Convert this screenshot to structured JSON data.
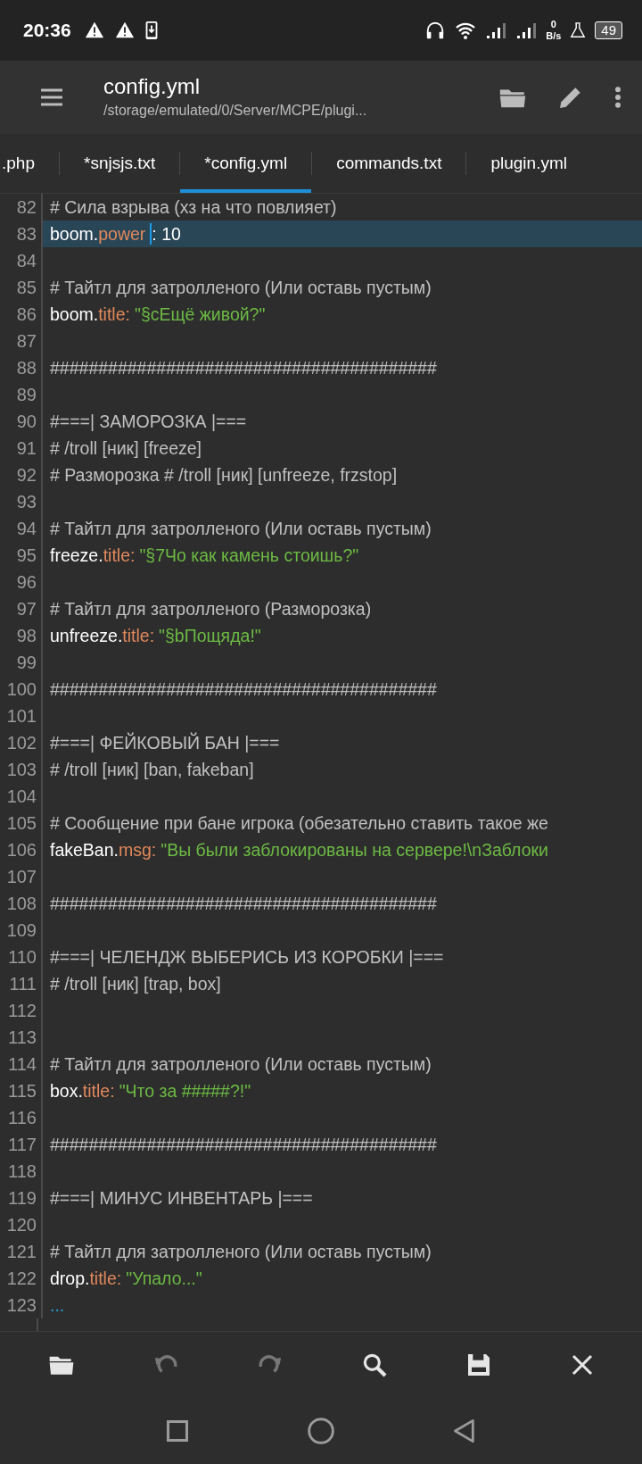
{
  "status_bar": {
    "time": "20:36",
    "net_speed": "0",
    "net_unit": "B/s",
    "battery": "49"
  },
  "app_bar": {
    "title": "config.yml",
    "path": "/storage/emulated/0/Server/MCPE/plugi..."
  },
  "tabs": [
    {
      "label": ".php",
      "selected": false
    },
    {
      "label": "*snjsjs.txt",
      "selected": false
    },
    {
      "label": "*config.yml",
      "selected": true
    },
    {
      "label": "commands.txt",
      "selected": false
    },
    {
      "label": "plugin.yml",
      "selected": false
    }
  ],
  "editor": {
    "lines": [
      {
        "number": "82",
        "current": false,
        "tokens": [
          {
            "kind": "comment",
            "text": "# Сила взрыва (хз на что повлияет)"
          }
        ]
      },
      {
        "number": "83",
        "current": true,
        "tokens": [
          {
            "kind": "key",
            "text": "boom."
          },
          {
            "kind": "prop",
            "text": "power"
          },
          {
            "kind": "cursor"
          },
          {
            "kind": "value",
            "text": ": 10"
          }
        ]
      },
      {
        "number": "84",
        "current": false
      },
      {
        "number": "85",
        "current": false,
        "tokens": [
          {
            "kind": "comment",
            "text": "# Тайтл для затролленого (Или оставь пустым)"
          }
        ]
      },
      {
        "number": "86",
        "current": false,
        "tokens": [
          {
            "kind": "key",
            "text": "boom."
          },
          {
            "kind": "prop",
            "text": "title:"
          },
          {
            "kind": "string",
            "text": "\"§cЕщё живой?\""
          }
        ]
      },
      {
        "number": "87",
        "current": false
      },
      {
        "number": "88",
        "current": false,
        "tokens": [
          {
            "kind": "comment",
            "text": "########################################"
          }
        ]
      },
      {
        "number": "89",
        "current": false
      },
      {
        "number": "90",
        "current": false,
        "tokens": [
          {
            "kind": "comment",
            "text": "#===| ЗАМОРОЗКА |==="
          }
        ]
      },
      {
        "number": "91",
        "current": false,
        "tokens": [
          {
            "kind": "comment",
            "text": "# /troll [ник] [freeze]"
          }
        ]
      },
      {
        "number": "92",
        "current": false,
        "tokens": [
          {
            "kind": "comment",
            "text": "# Разморозка # /troll [ник] [unfreeze, frzstop]"
          }
        ]
      },
      {
        "number": "93",
        "current": false
      },
      {
        "number": "94",
        "current": false,
        "tokens": [
          {
            "kind": "comment",
            "text": "# Тайтл для затролленого (Или оставь пустым)"
          }
        ]
      },
      {
        "number": "95",
        "current": false,
        "tokens": [
          {
            "kind": "key",
            "text": "freeze."
          },
          {
            "kind": "prop",
            "text": "title:"
          },
          {
            "kind": "string",
            "text": "\"§7Чо как камень стоишь?\""
          }
        ]
      },
      {
        "number": "96",
        "current": false
      },
      {
        "number": "97",
        "current": false,
        "tokens": [
          {
            "kind": "comment",
            "text": "# Тайтл для затролленого (Разморозка)"
          }
        ]
      },
      {
        "number": "98",
        "current": false,
        "tokens": [
          {
            "kind": "key",
            "text": "unfreeze."
          },
          {
            "kind": "prop",
            "text": "title:"
          },
          {
            "kind": "string",
            "text": "\"§bПощяда!\""
          }
        ]
      },
      {
        "number": "99",
        "current": false
      },
      {
        "number": "100",
        "current": false,
        "tokens": [
          {
            "kind": "comment",
            "text": "########################################"
          }
        ]
      },
      {
        "number": "101",
        "current": false
      },
      {
        "number": "102",
        "current": false,
        "tokens": [
          {
            "kind": "comment",
            "text": "#===| ФЕЙКОВЫЙ БАН |==="
          }
        ]
      },
      {
        "number": "103",
        "current": false,
        "tokens": [
          {
            "kind": "comment",
            "text": "# /troll [ник] [ban, fakeban]"
          }
        ]
      },
      {
        "number": "104",
        "current": false
      },
      {
        "number": "105",
        "current": false,
        "tokens": [
          {
            "kind": "comment",
            "text": "# Сообщение при бане игрока (обезательно ставить такое же"
          }
        ]
      },
      {
        "number": "106",
        "current": false,
        "tokens": [
          {
            "kind": "key",
            "text": "fakeBan."
          },
          {
            "kind": "prop",
            "text": "msg:"
          },
          {
            "kind": "string",
            "text": "\"Вы были заблокированы на сервере!\\nЗаблоки"
          }
        ]
      },
      {
        "number": "107",
        "current": false
      },
      {
        "number": "108",
        "current": false,
        "tokens": [
          {
            "kind": "comment",
            "text": "########################################"
          }
        ]
      },
      {
        "number": "109",
        "current": false
      },
      {
        "number": "110",
        "current": false,
        "tokens": [
          {
            "kind": "comment",
            "text": "#===| ЧЕЛЕНДЖ ВЫБЕРИСЬ ИЗ КОРОБКИ |==="
          }
        ]
      },
      {
        "number": "111",
        "current": false,
        "tokens": [
          {
            "kind": "comment",
            "text": "# /troll [ник] [trap, box]"
          }
        ]
      },
      {
        "number": "112",
        "current": false
      },
      {
        "number": "113",
        "current": false
      },
      {
        "number": "114",
        "current": false,
        "tokens": [
          {
            "kind": "comment",
            "text": "# Тайтл для затролленого (Или оставь пустым)"
          }
        ]
      },
      {
        "number": "115",
        "current": false,
        "tokens": [
          {
            "kind": "key",
            "text": "box."
          },
          {
            "kind": "prop",
            "text": "title:"
          },
          {
            "kind": "string",
            "text": "\"Что за #####?!\""
          }
        ]
      },
      {
        "number": "116",
        "current": false
      },
      {
        "number": "117",
        "current": false,
        "tokens": [
          {
            "kind": "comment",
            "text": "########################################"
          }
        ]
      },
      {
        "number": "118",
        "current": false
      },
      {
        "number": "119",
        "current": false,
        "tokens": [
          {
            "kind": "comment",
            "text": "#===| МИНУС ИНВЕНТАРЬ |==="
          }
        ]
      },
      {
        "number": "120",
        "current": false
      },
      {
        "number": "121",
        "current": false,
        "tokens": [
          {
            "kind": "comment",
            "text": "# Тайтл для затролленого (Или оставь пустым)"
          }
        ]
      },
      {
        "number": "122",
        "current": false,
        "tokens": [
          {
            "kind": "key",
            "text": "drop."
          },
          {
            "kind": "prop",
            "text": "title:"
          },
          {
            "kind": "string",
            "text": "\"Упало...\""
          }
        ]
      },
      {
        "number": "123",
        "current": false,
        "tokens": [
          {
            "kind": "more",
            "text": "..."
          }
        ]
      }
    ]
  },
  "bottom_toolbar": [
    {
      "kind": "open",
      "disabled": false
    },
    {
      "kind": "undo",
      "disabled": true
    },
    {
      "kind": "redo",
      "disabled": true
    },
    {
      "kind": "search",
      "disabled": false
    },
    {
      "kind": "save",
      "disabled": false
    },
    {
      "kind": "close",
      "disabled": false
    }
  ]
}
